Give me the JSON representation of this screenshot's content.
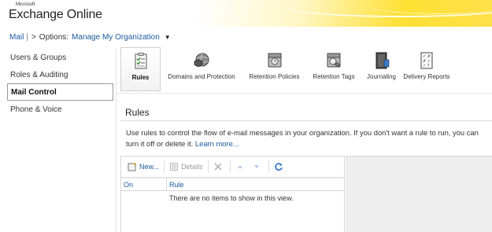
{
  "header": {
    "brand_small": "Microsoft",
    "brand_name": "Exchange Online"
  },
  "breadcrumb": {
    "mail": "Mail",
    "separator": "|",
    "arrow": ">",
    "options_label": "Options:",
    "scope": "Manage My Organization",
    "caret": "▼"
  },
  "leftnav": {
    "items": [
      {
        "label": "Users & Groups",
        "selected": false
      },
      {
        "label": "Roles & Auditing",
        "selected": false
      },
      {
        "label": "Mail Control",
        "selected": true
      },
      {
        "label": "Phone & Voice",
        "selected": false
      }
    ]
  },
  "ribbon": {
    "items": [
      {
        "label": "Rules",
        "icon": "rules-icon",
        "selected": true
      },
      {
        "label": "Domains and Protection",
        "icon": "domains-protection-icon",
        "selected": false
      },
      {
        "label": "Retention Policies",
        "icon": "retention-policies-icon",
        "selected": false
      },
      {
        "label": "Retention Tags",
        "icon": "retention-tags-icon",
        "selected": false
      },
      {
        "label": "Journaling",
        "icon": "journaling-icon",
        "selected": false
      },
      {
        "label": "Delivery Reports",
        "icon": "delivery-reports-icon",
        "selected": false
      }
    ]
  },
  "section": {
    "title": "Rules",
    "description": "Use rules to control the flow of e-mail messages in your organization. If you don't want a rule to run, you can turn it off or delete it.",
    "learn_more": "Learn more..."
  },
  "toolbar": {
    "new_label": "New...",
    "details_label": "Details"
  },
  "grid": {
    "columns": [
      "On",
      "Rule"
    ],
    "empty_message": "There are no items to show in this view."
  },
  "colors": {
    "link": "#1a5a9c",
    "accent": "#ffd21f"
  }
}
